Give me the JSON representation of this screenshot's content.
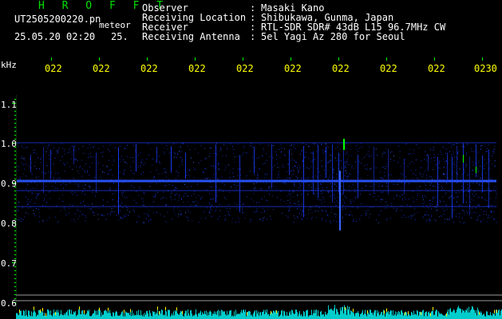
{
  "header": {
    "app_title": "H R O F F T",
    "file_name": "UT2505200220.pn",
    "meteor_label": "meteor",
    "datetime": "25.05.20 02:20",
    "datetime_truncated": "25.",
    "info": [
      {
        "label": "Observer",
        "value": "Masaki Kano"
      },
      {
        "label": "Receiving Location",
        "value": "Shibukawa, Gunma, Japan"
      },
      {
        "label": "Receiver",
        "value": "RTL-SDR SDR# 43dB L15 96.7MHz CW"
      },
      {
        "label": "Receiving Antenna",
        "value": "5el Yagi Az 280 for Seoul"
      }
    ]
  },
  "chart_data": {
    "type": "heatmap",
    "ylabel": "kHz",
    "y_ticks": [
      "1.1",
      "1.0",
      "0.9",
      "0.8",
      "0.7",
      "0.6"
    ],
    "x_ticks": [
      "022",
      "022",
      "022",
      "022",
      "022",
      "022",
      "022",
      "022",
      "022",
      "0230"
    ],
    "ylim": [
      0.58,
      1.14
    ],
    "bands_khz": [
      1.0,
      0.905,
      0.88,
      0.84
    ],
    "colors": {
      "background": "#000000",
      "signal": "#1a3cff",
      "strong": "#00ffff",
      "peak": "#ffff00",
      "tick": "#00ff00",
      "rule": "#aaaaaa",
      "meter": "#00cccc"
    }
  }
}
